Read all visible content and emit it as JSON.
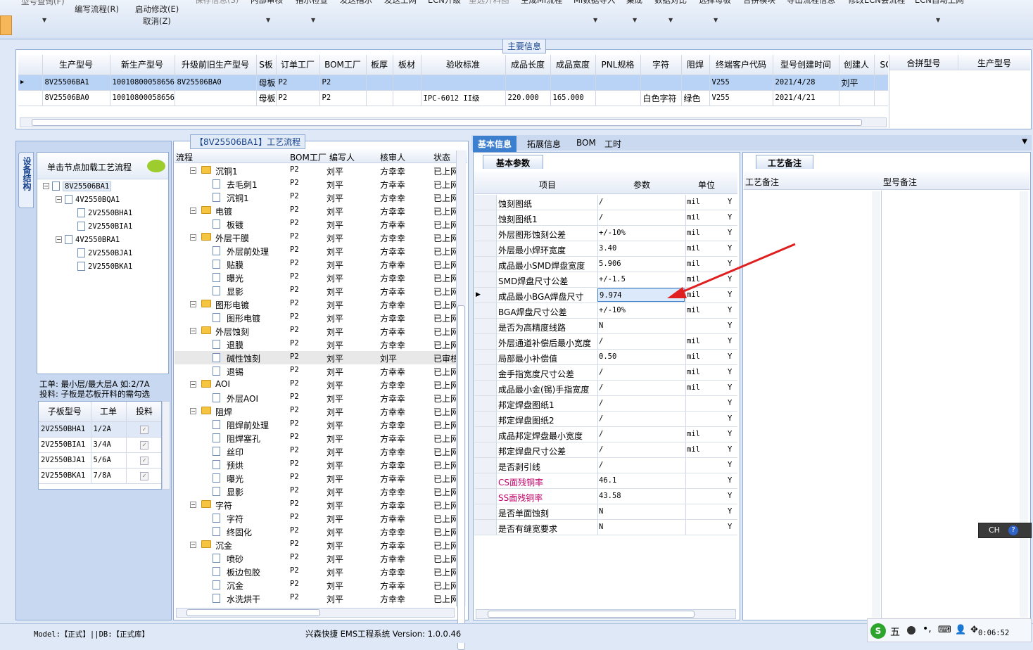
{
  "ribbon": {
    "items": [
      "编写流程(R)",
      "启动修改(E)",
      "取消(Z)",
      "保存信息(S)",
      "内部审核",
      "指示检查",
      "发送指示",
      "发送上网",
      "ECN升级",
      "重选开料图",
      "生成MI流程",
      "MI数据导入",
      "集成",
      "数据对比",
      "选择母板",
      "合拼模块",
      "导出流程信息",
      "修改ECN会流程",
      "ECN自动上网"
    ],
    "top_left": "型号查询(F)"
  },
  "main_info": {
    "title": "主要信息",
    "columns": [
      "生产型号",
      "新生产型号",
      "升级前旧生产型号",
      "S板",
      "订单工厂",
      "BOM工厂",
      "板厚",
      "板材",
      "验收标准",
      "成品长度",
      "成品宽度",
      "PNL规格",
      "字符",
      "阻焊",
      "终端客户代码",
      "型号创建时间",
      "创建人",
      "SG"
    ],
    "rows": [
      [
        "8V25506BA1",
        "10010800058656",
        "8V25506BA0",
        "母板",
        "P2",
        "P2",
        "",
        "",
        "",
        "",
        "",
        "",
        "",
        "",
        "V255",
        "2021/4/28",
        "刘平",
        ""
      ],
      [
        "8V25506BA0",
        "10010800058656",
        "",
        "母板",
        "P2",
        "P2",
        "",
        "",
        "IPC-6012 II级",
        "220.000",
        "165.000",
        "",
        "白色字符",
        "绿色",
        "V255",
        "2021/4/21",
        "",
        ""
      ]
    ],
    "merge_columns": [
      "合拼型号",
      "生产型号"
    ]
  },
  "left_panel": {
    "vtab": "设备结构",
    "hint": "单击节点加载工艺流程",
    "tree": [
      {
        "label": "8V25506BA1",
        "level": 0
      },
      {
        "label": "4V2550BQA1",
        "level": 1
      },
      {
        "label": "2V2550BHA1",
        "level": 2
      },
      {
        "label": "2V2550BIA1",
        "level": 2
      },
      {
        "label": "4V2550BRA1",
        "level": 1
      },
      {
        "label": "2V2550BJA1",
        "level": 2
      },
      {
        "label": "2V2550BKA1",
        "level": 2
      }
    ],
    "note1": "工单: 最小层/最大层A 如:2/7A",
    "note2": "投料: 子板是芯板开料的需勾选",
    "sub_columns": [
      "子板型号",
      "工单",
      "投料"
    ],
    "sub_rows": [
      [
        "2V2550BHA1",
        "1/2A"
      ],
      [
        "2V2550BIA1",
        "3/4A"
      ],
      [
        "2V2550BJA1",
        "5/6A"
      ],
      [
        "2V2550BKA1",
        "7/8A"
      ]
    ]
  },
  "process": {
    "title": "【8V25506BA1】工艺流程",
    "columns": [
      "流程",
      "BOM工厂",
      "编写人",
      "核审人",
      "状态"
    ],
    "rows": [
      {
        "label": "沉铜1",
        "type": "folder",
        "bom": "P2",
        "writer": "刘平",
        "reviewer": "方幸幸",
        "status": "已上网"
      },
      {
        "label": "去毛刺1",
        "type": "page",
        "bom": "P2",
        "writer": "刘平",
        "reviewer": "方幸幸",
        "status": "已上网"
      },
      {
        "label": "沉铜1",
        "type": "page",
        "bom": "P2",
        "writer": "刘平",
        "reviewer": "方幸幸",
        "status": "已上网"
      },
      {
        "label": "电镀",
        "type": "folder",
        "bom": "P2",
        "writer": "刘平",
        "reviewer": "方幸幸",
        "status": "已上网"
      },
      {
        "label": "板镀",
        "type": "page",
        "bom": "P2",
        "writer": "刘平",
        "reviewer": "方幸幸",
        "status": "已上网"
      },
      {
        "label": "外层干膜",
        "type": "folder",
        "bom": "P2",
        "writer": "刘平",
        "reviewer": "方幸幸",
        "status": "已上网"
      },
      {
        "label": "外层前处理",
        "type": "page",
        "bom": "P2",
        "writer": "刘平",
        "reviewer": "方幸幸",
        "status": "已上网"
      },
      {
        "label": "贴膜",
        "type": "page",
        "bom": "P2",
        "writer": "刘平",
        "reviewer": "方幸幸",
        "status": "已上网"
      },
      {
        "label": "曝光",
        "type": "page",
        "bom": "P2",
        "writer": "刘平",
        "reviewer": "方幸幸",
        "status": "已上网"
      },
      {
        "label": "显影",
        "type": "page",
        "bom": "P2",
        "writer": "刘平",
        "reviewer": "方幸幸",
        "status": "已上网"
      },
      {
        "label": "图形电镀",
        "type": "folder",
        "bom": "P2",
        "writer": "刘平",
        "reviewer": "方幸幸",
        "status": "已上网"
      },
      {
        "label": "图形电镀",
        "type": "page",
        "bom": "P2",
        "writer": "刘平",
        "reviewer": "方幸幸",
        "status": "已上网"
      },
      {
        "label": "外层蚀刻",
        "type": "folder",
        "bom": "P2",
        "writer": "刘平",
        "reviewer": "方幸幸",
        "status": "已上网"
      },
      {
        "label": "退膜",
        "type": "page",
        "bom": "P2",
        "writer": "刘平",
        "reviewer": "方幸幸",
        "status": "已上网"
      },
      {
        "label": "碱性蚀刻",
        "type": "page",
        "bom": "P2",
        "writer": "刘平",
        "reviewer": "刘平",
        "status": "已审核",
        "selected": true
      },
      {
        "label": "退锡",
        "type": "page",
        "bom": "P2",
        "writer": "刘平",
        "reviewer": "方幸幸",
        "status": "已上网"
      },
      {
        "label": "AOI",
        "type": "folder",
        "bom": "P2",
        "writer": "刘平",
        "reviewer": "方幸幸",
        "status": "已上网"
      },
      {
        "label": "外层AOI",
        "type": "page",
        "bom": "P2",
        "writer": "刘平",
        "reviewer": "方幸幸",
        "status": "已上网"
      },
      {
        "label": "阻焊",
        "type": "folder",
        "bom": "P2",
        "writer": "刘平",
        "reviewer": "方幸幸",
        "status": "已上网"
      },
      {
        "label": "阻焊前处理",
        "type": "page",
        "bom": "P2",
        "writer": "刘平",
        "reviewer": "方幸幸",
        "status": "已上网"
      },
      {
        "label": "阻焊塞孔",
        "type": "page",
        "bom": "P2",
        "writer": "刘平",
        "reviewer": "方幸幸",
        "status": "已上网"
      },
      {
        "label": "丝印",
        "type": "page",
        "bom": "P2",
        "writer": "刘平",
        "reviewer": "方幸幸",
        "status": "已上网"
      },
      {
        "label": "预烘",
        "type": "page",
        "bom": "P2",
        "writer": "刘平",
        "reviewer": "方幸幸",
        "status": "已上网"
      },
      {
        "label": "曝光",
        "type": "page",
        "bom": "P2",
        "writer": "刘平",
        "reviewer": "方幸幸",
        "status": "已上网"
      },
      {
        "label": "显影",
        "type": "page",
        "bom": "P2",
        "writer": "刘平",
        "reviewer": "方幸幸",
        "status": "已上网"
      },
      {
        "label": "字符",
        "type": "folder",
        "bom": "P2",
        "writer": "刘平",
        "reviewer": "方幸幸",
        "status": "已上网"
      },
      {
        "label": "字符",
        "type": "page",
        "bom": "P2",
        "writer": "刘平",
        "reviewer": "方幸幸",
        "status": "已上网"
      },
      {
        "label": "终固化",
        "type": "page",
        "bom": "P2",
        "writer": "刘平",
        "reviewer": "方幸幸",
        "status": "已上网"
      },
      {
        "label": "沉金",
        "type": "folder",
        "bom": "P2",
        "writer": "刘平",
        "reviewer": "方幸幸",
        "status": "已上网"
      },
      {
        "label": "喷砂",
        "type": "page",
        "bom": "P2",
        "writer": "刘平",
        "reviewer": "方幸幸",
        "status": "已上网"
      },
      {
        "label": "板边包胶",
        "type": "page",
        "bom": "P2",
        "writer": "刘平",
        "reviewer": "方幸幸",
        "status": "已上网"
      },
      {
        "label": "沉金",
        "type": "page",
        "bom": "P2",
        "writer": "刘平",
        "reviewer": "方幸幸",
        "status": "已上网"
      },
      {
        "label": "水洗烘干",
        "type": "page",
        "bom": "P2",
        "writer": "刘平",
        "reviewer": "方幸幸",
        "status": "已上网"
      }
    ]
  },
  "detail": {
    "tabs": [
      "基本信息",
      "拓展信息",
      "BOM",
      "工时"
    ],
    "subtab": "基本参数",
    "columns": [
      "项目",
      "参数",
      "单位"
    ],
    "rows": [
      {
        "item": "蚀刻图纸",
        "param": "/",
        "unit": "mil",
        "flag": "Y"
      },
      {
        "item": "蚀刻图纸1",
        "param": "/",
        "unit": "mil",
        "flag": "Y"
      },
      {
        "item": "外层图形蚀刻公差",
        "param": "+/-10%",
        "unit": "mil",
        "flag": "Y"
      },
      {
        "item": "外层最小焊环宽度",
        "param": "3.40",
        "unit": "mil",
        "flag": "Y"
      },
      {
        "item": "成品最小SMD焊盘宽度",
        "param": "5.906",
        "unit": "mil",
        "flag": "Y"
      },
      {
        "item": "SMD焊盘尺寸公差",
        "param": "+/-1.5",
        "unit": "mil",
        "flag": "Y"
      },
      {
        "item": "成品最小BGA焊盘尺寸",
        "param": "9.974",
        "unit": "mil",
        "flag": "Y",
        "current": true
      },
      {
        "item": "BGA焊盘尺寸公差",
        "param": "+/-10%",
        "unit": "mil",
        "flag": "Y"
      },
      {
        "item": "是否为高精度线路",
        "param": "N",
        "unit": "",
        "flag": "Y"
      },
      {
        "item": "外层通道补偿后最小宽度",
        "param": "/",
        "unit": "mil",
        "flag": "Y"
      },
      {
        "item": "局部最小补偿值",
        "param": "0.50",
        "unit": "mil",
        "flag": "Y"
      },
      {
        "item": "金手指宽度尺寸公差",
        "param": "/",
        "unit": "mil",
        "flag": "Y"
      },
      {
        "item": "成品最小金(锡)手指宽度",
        "param": "/",
        "unit": "mil",
        "flag": "Y"
      },
      {
        "item": "邦定焊盘图纸1",
        "param": "/",
        "unit": "",
        "flag": "Y"
      },
      {
        "item": "邦定焊盘图纸2",
        "param": "/",
        "unit": "",
        "flag": "Y"
      },
      {
        "item": "成品邦定焊盘最小宽度",
        "param": "/",
        "unit": "mil",
        "flag": "Y"
      },
      {
        "item": "邦定焊盘尺寸公差",
        "param": "/",
        "unit": "mil",
        "flag": "Y"
      },
      {
        "item": "是否剥引线",
        "param": "/",
        "unit": "",
        "flag": "Y"
      },
      {
        "item": "CS面残铜率",
        "param": "46.1",
        "unit": "",
        "flag": "Y",
        "pink": true
      },
      {
        "item": "SS面残铜率",
        "param": "43.58",
        "unit": "",
        "flag": "Y",
        "pink": true
      },
      {
        "item": "是否单面蚀刻",
        "param": "N",
        "unit": "",
        "flag": "Y"
      },
      {
        "item": "是否有缝宽要求",
        "param": "N",
        "unit": "",
        "flag": "Y"
      }
    ]
  },
  "remarks": {
    "tab": "工艺备注",
    "col1": "工艺备注",
    "col2": "型号备注"
  },
  "ime": {
    "lang": "CH",
    "ime_label": "五"
  },
  "status": {
    "left": "Model:【正式】||DB:【正式库】",
    "center": "兴森快捷 EMS工程系统 Version: 1.0.0.46",
    "time": "0:06:52"
  },
  "colors": {
    "selection": "#b8d3f5",
    "tab_active": "#3d7fcf",
    "pink": "#c0006a",
    "arrow": "#e02020"
  }
}
